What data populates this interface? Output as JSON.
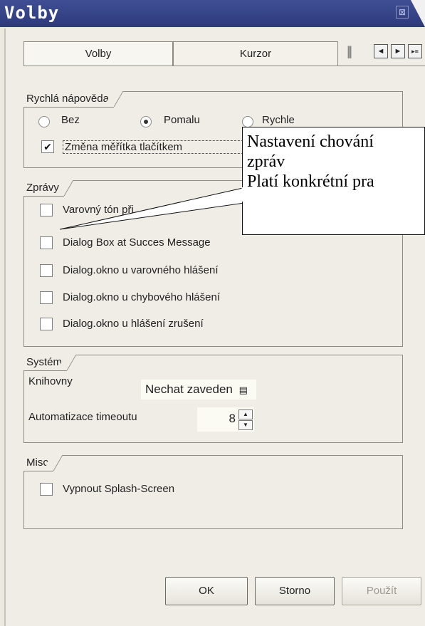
{
  "window": {
    "title": "Volby",
    "close_glyph": "⊠"
  },
  "tabs": [
    {
      "label": "Volby",
      "active": true
    },
    {
      "label": "Kurzor",
      "active": false
    }
  ],
  "tab_scroll": {
    "left": "◄",
    "right": "►",
    "menu": "▸≡"
  },
  "quick_help": {
    "legend": "Rychlá nápověda",
    "options": [
      "Bez",
      "Pomalu",
      "Rychle"
    ],
    "selected": "Pomalu",
    "scale_checkbox": {
      "label": "Změna měřítka tlačítkem",
      "checked": true
    }
  },
  "messages": {
    "legend": "Zprávy",
    "items": [
      "Varovný tón při hlášení",
      "Dialog Box at Succes Message",
      "Dialog.okno u varovného hlášení",
      "Dialog.okno u chybového hlášení",
      "Dialog.okno u hlášení zrušení"
    ]
  },
  "system": {
    "legend": "Systém",
    "libraries_label": "Knihovny",
    "libraries_value": "Nechat zaveden",
    "timeout_label": "Automatizace timeoutu",
    "timeout_value": "8"
  },
  "misc": {
    "legend": "Misc",
    "splash_label": "Vypnout Splash-Screen"
  },
  "buttons": {
    "ok": "OK",
    "cancel": "Storno",
    "apply": "Použít"
  },
  "callout": {
    "lines": [
      "Nastavení chování",
      "zpráv",
      "Platí konkrétní pra"
    ]
  },
  "colors": {
    "title_bar": "#2d3a7c",
    "window_bg": "#efede6",
    "callout_bg": "#ffffff"
  }
}
